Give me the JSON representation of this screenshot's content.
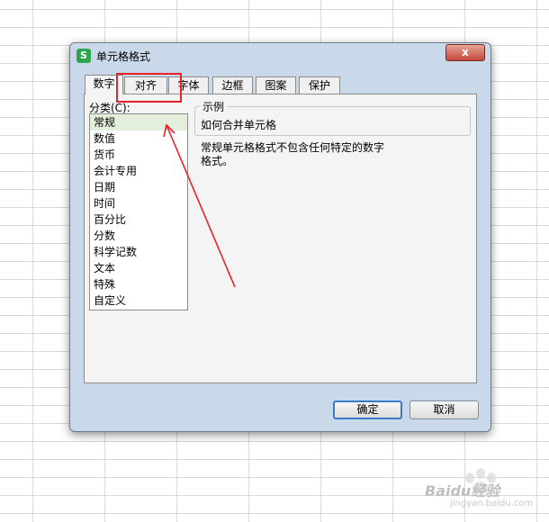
{
  "dialog": {
    "title": "单元格格式",
    "app_icon": "S",
    "close_label": "x"
  },
  "tabs": [
    {
      "label": "数字",
      "active": true
    },
    {
      "label": "对齐",
      "active": false
    },
    {
      "label": "字体",
      "active": false
    },
    {
      "label": "边框",
      "active": false
    },
    {
      "label": "图案",
      "active": false
    },
    {
      "label": "保护",
      "active": false
    }
  ],
  "category": {
    "label": "分类(C):",
    "items": [
      "常规",
      "数值",
      "货币",
      "会计专用",
      "日期",
      "时间",
      "百分比",
      "分数",
      "科学记数",
      "文本",
      "特殊",
      "自定义"
    ],
    "selected": "常规"
  },
  "sample": {
    "legend": "示例",
    "value": "如何合并单元格"
  },
  "description": "常规单元格格式不包含任何特定的数字格式。",
  "buttons": {
    "ok": "确定",
    "cancel": "取消"
  },
  "annotation": {
    "color": "#e8212b"
  },
  "watermark": {
    "brand": "Baidu经验",
    "site": "jingyan.baidu.com"
  }
}
